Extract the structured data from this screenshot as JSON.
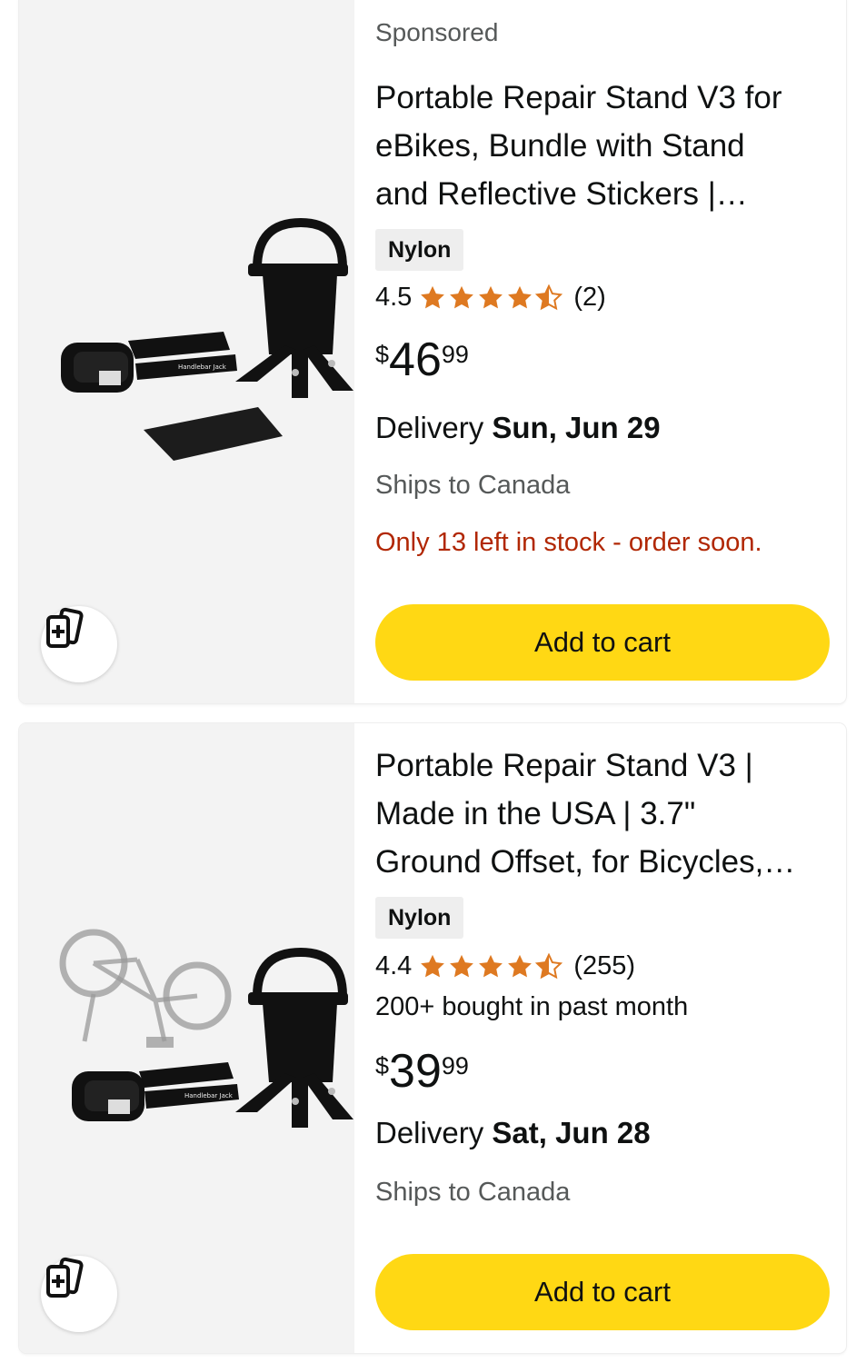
{
  "products": [
    {
      "sponsored_label": "Sponsored",
      "title_line1": "Portable Repair Stand V3 for",
      "title_line2": "eBikes, Bundle with Stand",
      "title_line3": "and Reflective Stickers |…",
      "badge": "Nylon",
      "rating_value": "4.5",
      "rating_stars": 4.5,
      "rating_count": "(2)",
      "price_currency": "$",
      "price_whole": "46",
      "price_fraction": "99",
      "delivery_prefix": "Delivery",
      "delivery_date": "Sun, Jun 29",
      "ships_to": "Ships to Canada",
      "stock_note": "Only 13 left in stock - order soon.",
      "add_to_cart": "Add to cart",
      "image_label": "Handlebar Jack"
    },
    {
      "title_line1": "Portable Repair Stand V3 |",
      "title_line2": "Made in the USA | 3.7\"",
      "title_line3": "Ground Offset, for Bicycles,…",
      "badge": "Nylon",
      "rating_value": "4.4",
      "rating_stars": 4.4,
      "rating_count": "(255)",
      "bought_note": "200+ bought in past month",
      "price_currency": "$",
      "price_whole": "39",
      "price_fraction": "99",
      "delivery_prefix": "Delivery",
      "delivery_date": "Sat, Jun 28",
      "ships_to": "Ships to Canada",
      "add_to_cart": "Add to cart",
      "image_label": "Handlebar Jack"
    }
  ],
  "icons": {
    "compare": "compare-cards-icon",
    "star_full": "star-filled-icon",
    "star_half": "star-half-icon"
  },
  "colors": {
    "star": "#de7921",
    "button": "#ffd814",
    "stock_warning": "#b12704",
    "secondary_text": "#565959"
  }
}
